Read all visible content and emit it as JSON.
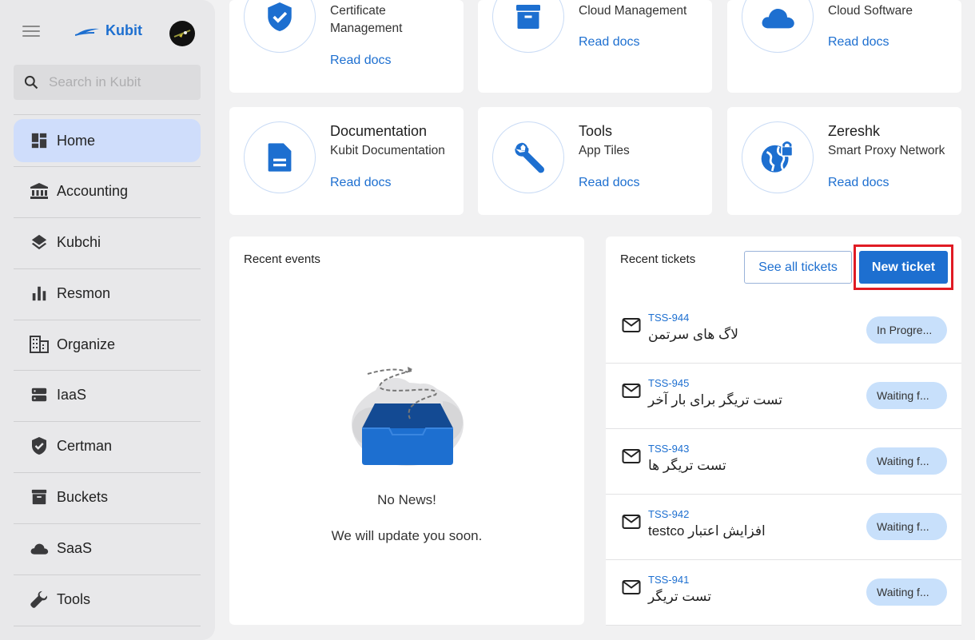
{
  "app": {
    "name": "Kubit"
  },
  "search": {
    "placeholder": "Search in Kubit"
  },
  "sidebar": {
    "items": [
      {
        "label": "Home",
        "icon": "dashboard-icon"
      },
      {
        "label": "Accounting",
        "icon": "bank-icon"
      },
      {
        "label": "Kubchi",
        "icon": "layers-icon"
      },
      {
        "label": "Resmon",
        "icon": "bar-chart-icon"
      },
      {
        "label": "Organize",
        "icon": "building-icon"
      },
      {
        "label": "IaaS",
        "icon": "server-icon"
      },
      {
        "label": "Certman",
        "icon": "shield-check-icon"
      },
      {
        "label": "Buckets",
        "icon": "archive-icon"
      },
      {
        "label": "SaaS",
        "icon": "cloud-icon"
      },
      {
        "label": "Tools",
        "icon": "wrench-icon"
      }
    ]
  },
  "services": [
    {
      "title": "",
      "subtitle": "Certificate Management",
      "link": "Read docs",
      "icon": "shield-check-icon"
    },
    {
      "title": "",
      "subtitle": "Cloud Management",
      "link": "Read docs",
      "icon": "archive-icon"
    },
    {
      "title": "",
      "subtitle": "Cloud Software",
      "link": "Read docs",
      "icon": "cloud-icon"
    },
    {
      "title": "Documentation",
      "subtitle": "Kubit Documentation",
      "link": "Read docs",
      "icon": "document-icon"
    },
    {
      "title": "Tools",
      "subtitle": "App Tiles",
      "link": "Read docs",
      "icon": "wrench-icon"
    },
    {
      "title": "Zereshk",
      "subtitle": "Smart Proxy Network",
      "link": "Read docs",
      "icon": "globe-lock-icon"
    }
  ],
  "events": {
    "title": "Recent events",
    "empty_title": "No News!",
    "empty_text": "We will update you soon."
  },
  "tickets": {
    "title": "Recent tickets",
    "see_all": "See all tickets",
    "new_ticket": "New ticket",
    "items": [
      {
        "id": "TSS-944",
        "subject": "لاگ های سرتمن",
        "status": "In Progre..."
      },
      {
        "id": "TSS-945",
        "subject": "تست تریگر برای بار آخر",
        "status": "Waiting f..."
      },
      {
        "id": "TSS-943",
        "subject": "تست تریگر ها",
        "status": "Waiting f..."
      },
      {
        "id": "TSS-942",
        "subject": "افزایش اعتبار testco",
        "status": "Waiting f..."
      },
      {
        "id": "TSS-941",
        "subject": "تست تریگر",
        "status": "Waiting f..."
      }
    ]
  },
  "colors": {
    "accent": "#1d6fd0",
    "highlight": "#e01b24",
    "status_bg": "#c8e0fb",
    "active_nav": "#cfddfb"
  }
}
